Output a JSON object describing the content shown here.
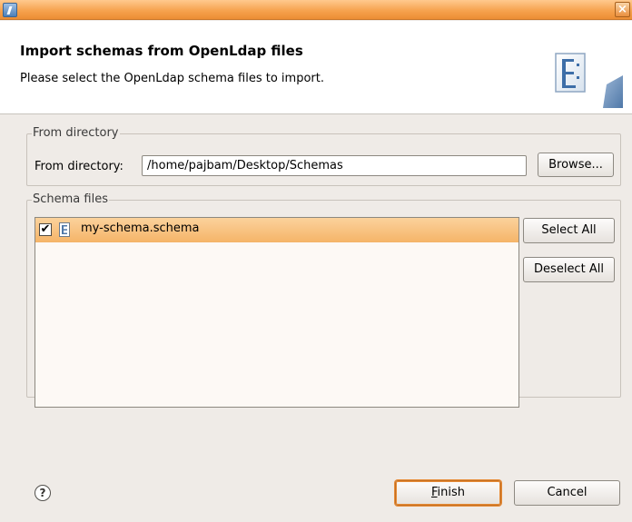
{
  "window": {
    "close_glyph": "×",
    "app_icon": "eclipse-app-icon"
  },
  "header": {
    "title": "Import schemas from OpenLdap files",
    "description": "Please select the OpenLdap schema files to import.",
    "graphic": "schema-import-wizard-graphic"
  },
  "from_directory": {
    "group_label": "From directory",
    "field_label": "From directory:",
    "value": "/home/pajbam/Desktop/Schemas",
    "browse_label": "Browse..."
  },
  "schema_files": {
    "group_label": "Schema files",
    "items": [
      {
        "label": "my-schema.schema",
        "checked": true,
        "check_glyph": "✔"
      }
    ],
    "select_all_label": "Select All",
    "deselect_all_label": "Deselect All"
  },
  "footer": {
    "help_glyph": "?",
    "finish_mnemonic": "F",
    "finish_rest": "inish",
    "cancel_label": "Cancel"
  },
  "colors": {
    "titlebar": "#f6a34f",
    "selection": "#f8c27f",
    "dialog_bg": "#efebe7"
  }
}
